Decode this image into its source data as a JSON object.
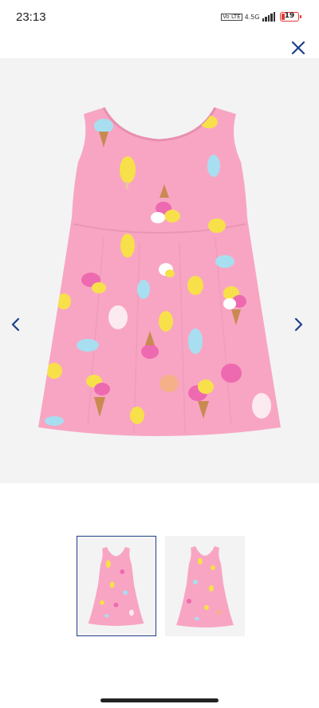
{
  "status_bar": {
    "time": "23:13",
    "volte": "Vo LTE",
    "network": "4.5G",
    "battery": "19",
    "battery_fraction": 0.19,
    "battery_color": "#e53935"
  },
  "toolbar": {
    "close_icon": "close-icon",
    "accent_color": "#1f3f8a"
  },
  "gallery": {
    "main_image": "pink-ice-cream-print-dress",
    "prev_icon": "chevron-left-icon",
    "next_icon": "chevron-right-icon",
    "selected_index": 0,
    "thumbnails": [
      {
        "image": "pink-ice-cream-print-dress-front",
        "selected": true
      },
      {
        "image": "pink-ice-cream-print-dress-back",
        "selected": false
      }
    ]
  }
}
